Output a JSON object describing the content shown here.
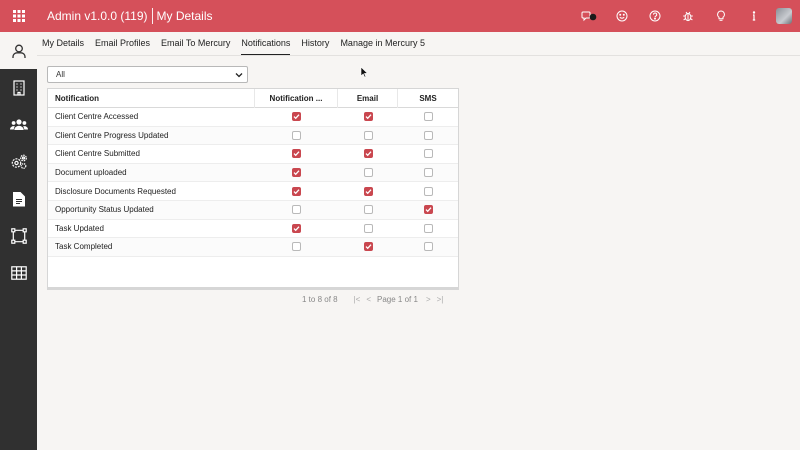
{
  "app": {
    "title": "Admin v1.0.0 (119)",
    "section": "My Details"
  },
  "header_icons": [
    "toggle-icon",
    "smiley-icon",
    "help-icon",
    "bug-icon",
    "lightbulb-icon",
    "info-icon",
    "user-avatar"
  ],
  "sidebar": {
    "items": [
      "user-icon",
      "building-icon",
      "group-icon",
      "settings-gears-icon",
      "document-icon",
      "network-icon",
      "table-icon"
    ],
    "active": "user-icon"
  },
  "tabs": [
    {
      "label": "My Details",
      "active": false
    },
    {
      "label": "Email Profiles",
      "active": false
    },
    {
      "label": "Email To Mercury",
      "active": false
    },
    {
      "label": "Notifications",
      "active": true
    },
    {
      "label": "History",
      "active": false
    },
    {
      "label": "Manage in Mercury 5",
      "active": false
    }
  ],
  "filter": {
    "value": "All"
  },
  "grid": {
    "columns": [
      "Notification",
      "Notification ...",
      "Email",
      "SMS"
    ],
    "rows": [
      {
        "name": "Client Centre Accessed",
        "notification": true,
        "email": true,
        "sms": false
      },
      {
        "name": "Client Centre Progress Updated",
        "notification": false,
        "email": false,
        "sms": false
      },
      {
        "name": "Client Centre Submitted",
        "notification": true,
        "email": true,
        "sms": false
      },
      {
        "name": "Document uploaded",
        "notification": true,
        "email": false,
        "sms": false
      },
      {
        "name": "Disclosure Documents Requested",
        "notification": true,
        "email": true,
        "sms": false
      },
      {
        "name": "Opportunity Status Updated",
        "notification": false,
        "email": false,
        "sms": true
      },
      {
        "name": "Task Updated",
        "notification": true,
        "email": false,
        "sms": false
      },
      {
        "name": "Task Completed",
        "notification": false,
        "email": true,
        "sms": false
      }
    ]
  },
  "pagination": {
    "count": "1 to 8 of 8",
    "page_label": "Page 1 of 1"
  },
  "colors": {
    "brand": "#d5505a",
    "sidebar": "#303030",
    "checkbox_on": "#c9474f"
  }
}
